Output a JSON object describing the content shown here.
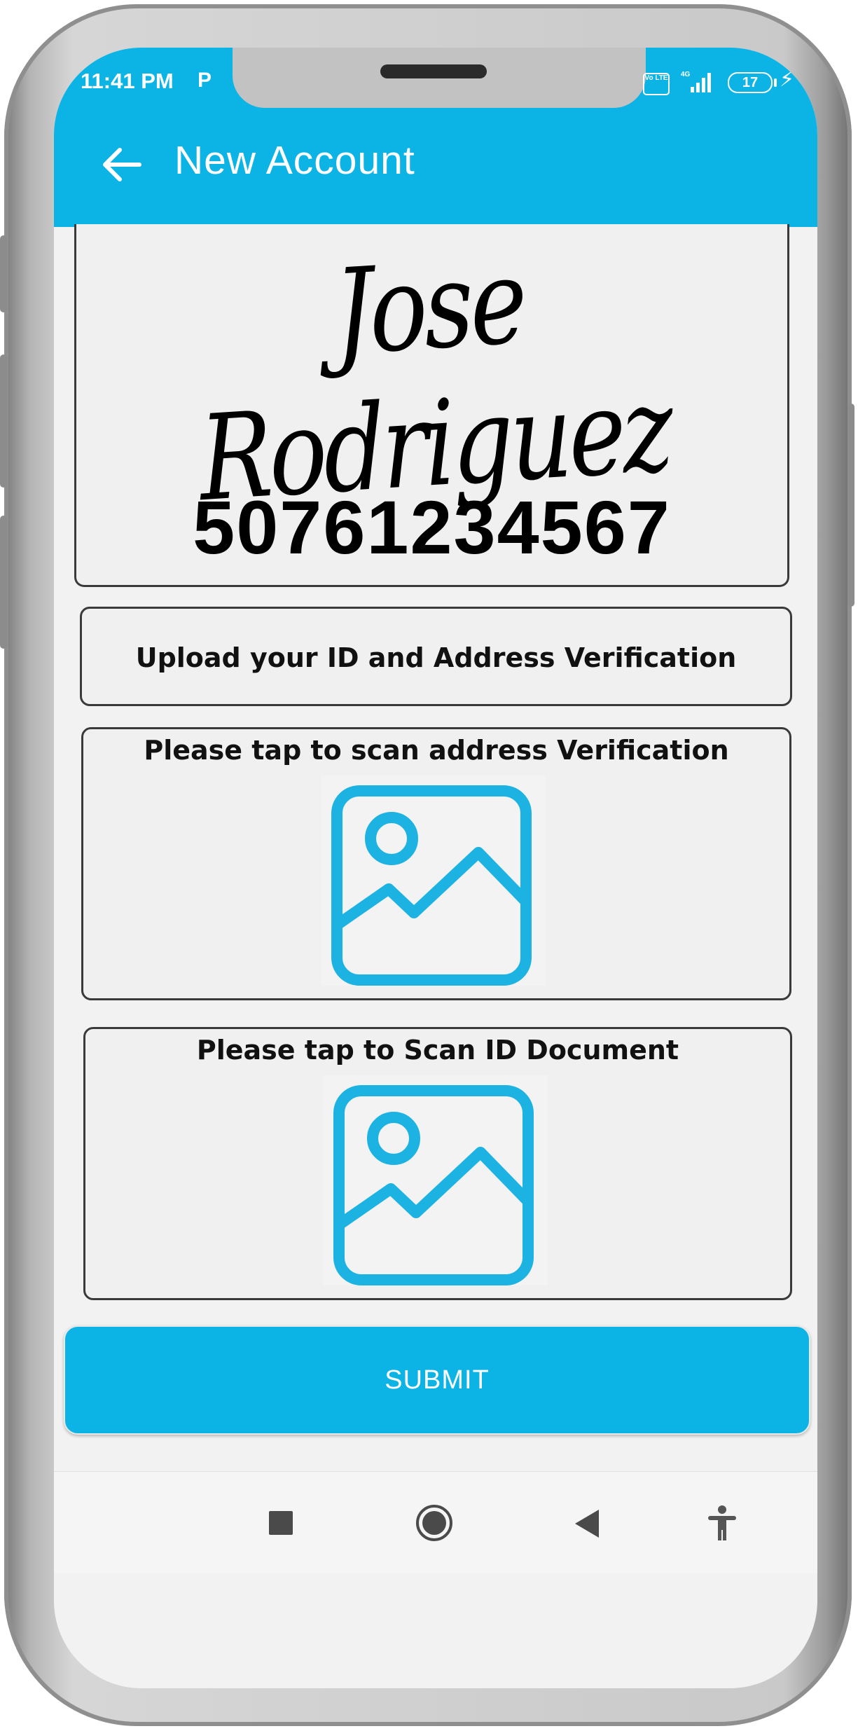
{
  "status_bar": {
    "time": "11:41 PM",
    "parking_badge": "P",
    "volte": "Vo LTE",
    "network": "4G",
    "battery": "17"
  },
  "app_bar": {
    "title": "New Account",
    "back_icon": "arrow-left-icon"
  },
  "account": {
    "name_signature": "Jose Rodriguez",
    "number": "50761234567"
  },
  "upload_prompt": "Upload your ID and Address Verification",
  "address_scan": {
    "label": "Please tap to scan address Verification",
    "icon": "image-placeholder-icon"
  },
  "id_scan": {
    "label": "Please tap to Scan ID Document",
    "icon": "image-placeholder-icon"
  },
  "submit_label": "SUBMIT",
  "nav": {
    "recents_icon": "square-icon",
    "home_icon": "circle-icon",
    "back_icon": "triangle-back-icon",
    "accessibility_icon": "accessibility-icon"
  },
  "colors": {
    "accent": "#0cb4e6",
    "card_border": "#3a3a3a",
    "background": "#f2f2f2"
  }
}
